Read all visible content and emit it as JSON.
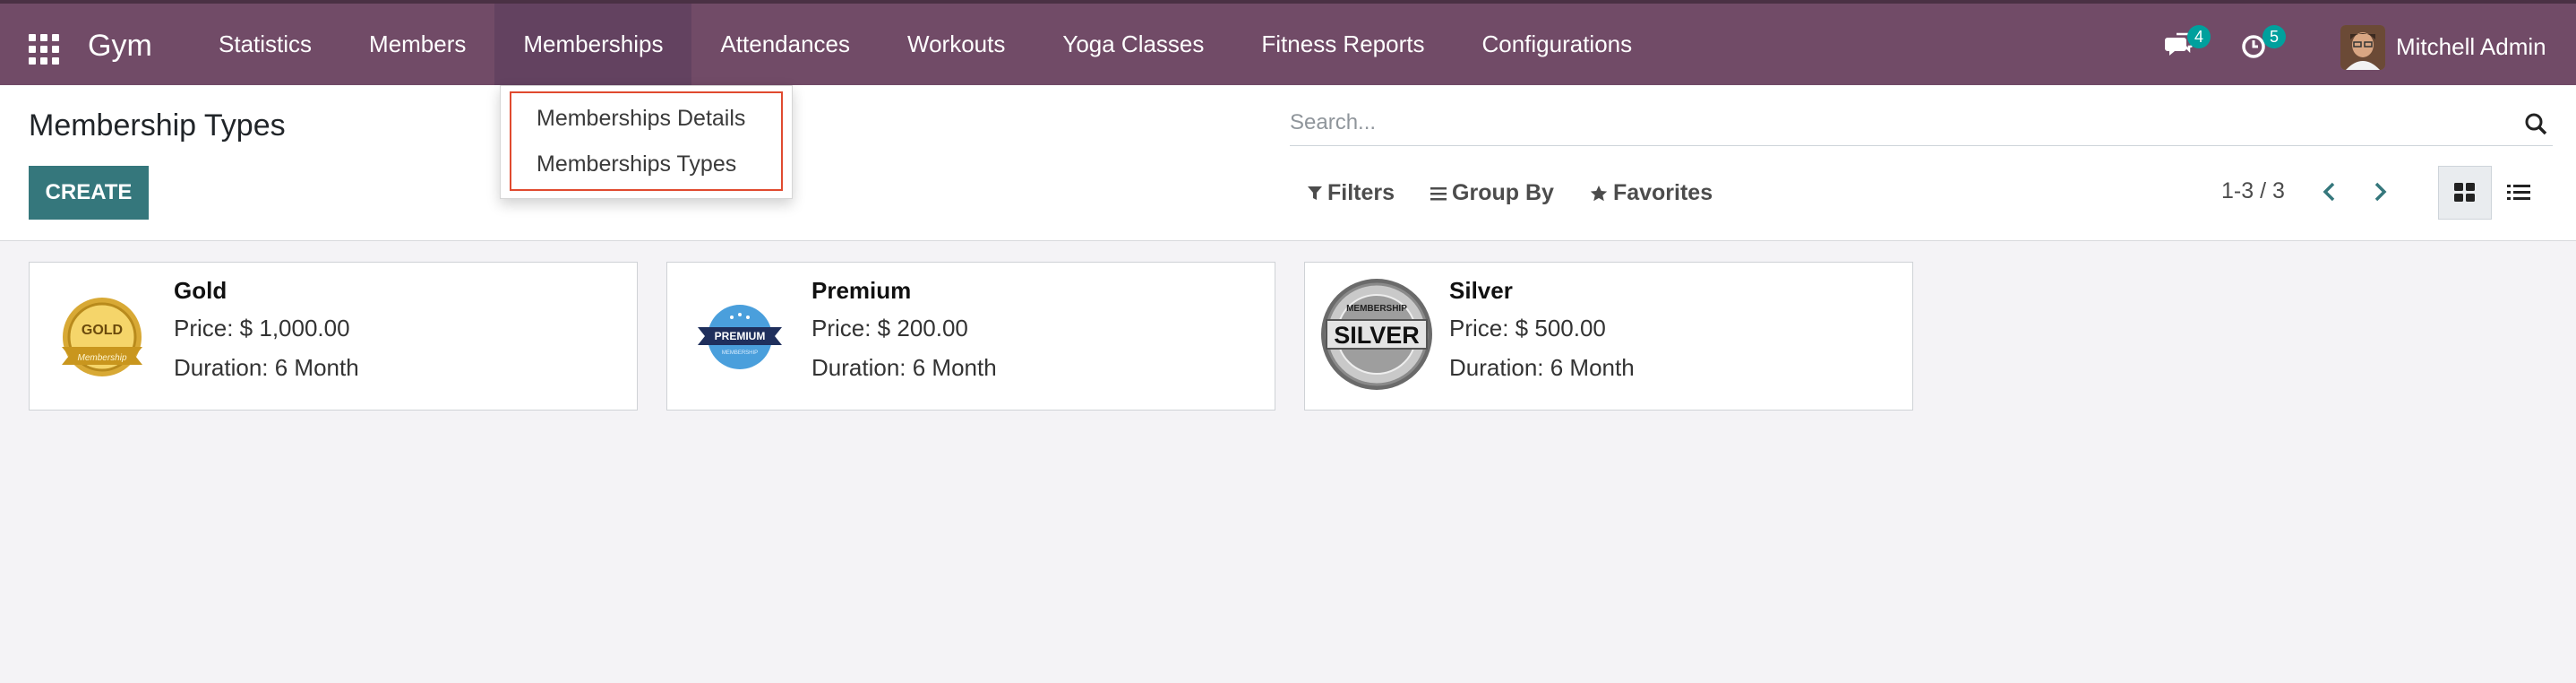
{
  "navbar": {
    "brand": "Gym",
    "menu": [
      {
        "label": "Statistics"
      },
      {
        "label": "Members"
      },
      {
        "label": "Memberships"
      },
      {
        "label": "Attendances"
      },
      {
        "label": "Workouts"
      },
      {
        "label": "Yoga Classes"
      },
      {
        "label": "Fitness Reports"
      },
      {
        "label": "Configurations"
      }
    ],
    "messages_count": "4",
    "activities_count": "5",
    "user_name": "Mitchell Admin",
    "background_color": "#714b67"
  },
  "dropdown": {
    "items": [
      {
        "label": "Memberships Details"
      },
      {
        "label": "Memberships Types"
      }
    ],
    "highlight_color": "#e04a2f"
  },
  "control_panel": {
    "title": "Membership Types",
    "create_label": "CREATE",
    "search_placeholder": "Search...",
    "filters_label": "Filters",
    "group_by_label": "Group By",
    "favorites_label": "Favorites",
    "pager_text": "1-3 / 3",
    "accent_color": "#35777c"
  },
  "cards": [
    {
      "name": "Gold",
      "price": "Price: $ 1,000.00",
      "duration": "Duration: 6 Month",
      "image_icon": "gold-membership-badge",
      "badge_text": "GOLD",
      "badge_sub": "Membership"
    },
    {
      "name": "Premium",
      "price": "Price: $ 200.00",
      "duration": "Duration: 6 Month",
      "image_icon": "premium-membership-badge",
      "badge_text": "PREMIUM",
      "badge_sub": "MEMBERSHIP"
    },
    {
      "name": "Silver",
      "price": "Price: $ 500.00",
      "duration": "Duration: 6 Month",
      "image_icon": "silver-membership-badge",
      "badge_text": "SILVER",
      "badge_sub": "MEMBERSHIP"
    }
  ]
}
